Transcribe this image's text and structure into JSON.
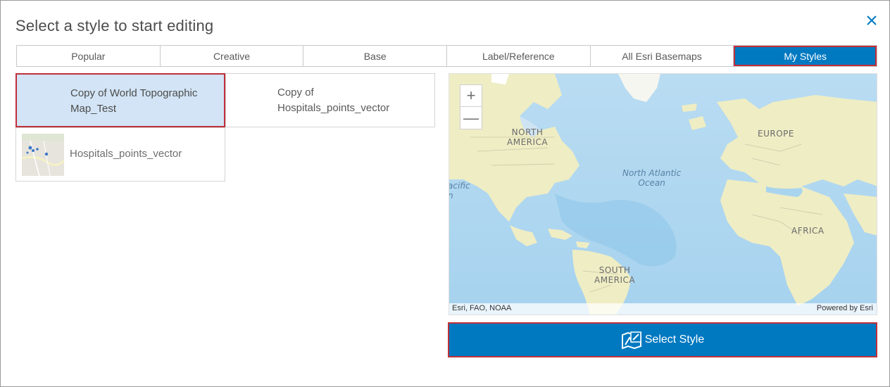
{
  "dialog": {
    "title": "Select a style to start editing",
    "close_icon": "close-icon"
  },
  "tabs": [
    {
      "label": "Popular",
      "active": false
    },
    {
      "label": "Creative",
      "active": false
    },
    {
      "label": "Base",
      "active": false
    },
    {
      "label": "Label/Reference",
      "active": false
    },
    {
      "label": "All Esri Basemaps",
      "active": false
    },
    {
      "label": "My Styles",
      "active": true
    }
  ],
  "styles": [
    {
      "name": "Copy of World Topographic Map_Test",
      "selected": true,
      "thumbnail": "none"
    },
    {
      "name": "Copy of Hospitals_points_vector",
      "selected": false,
      "thumbnail": "none"
    },
    {
      "name": "Hospitals_points_vector",
      "selected": false,
      "thumbnail": "map-thumbnail"
    }
  ],
  "map": {
    "zoom_in": "+",
    "zoom_out": "—",
    "labels": {
      "north_america": "NORTH\nAMERICA",
      "europe": "EUROPE",
      "north_atlantic": "North Atlantic\nOcean",
      "pacific": "acific\nn",
      "africa": "AFRICA",
      "south_america": "SOUTH\nAMERICA"
    },
    "attribution_left": "Esri, FAO, NOAA",
    "attribution_right": "Powered by Esri"
  },
  "select_button": {
    "label": "Select Style",
    "icon": "map-edit-icon"
  },
  "colors": {
    "accent": "#0079c1",
    "selection_border": "#c0303a",
    "selected_bg": "#d2e4f5"
  }
}
